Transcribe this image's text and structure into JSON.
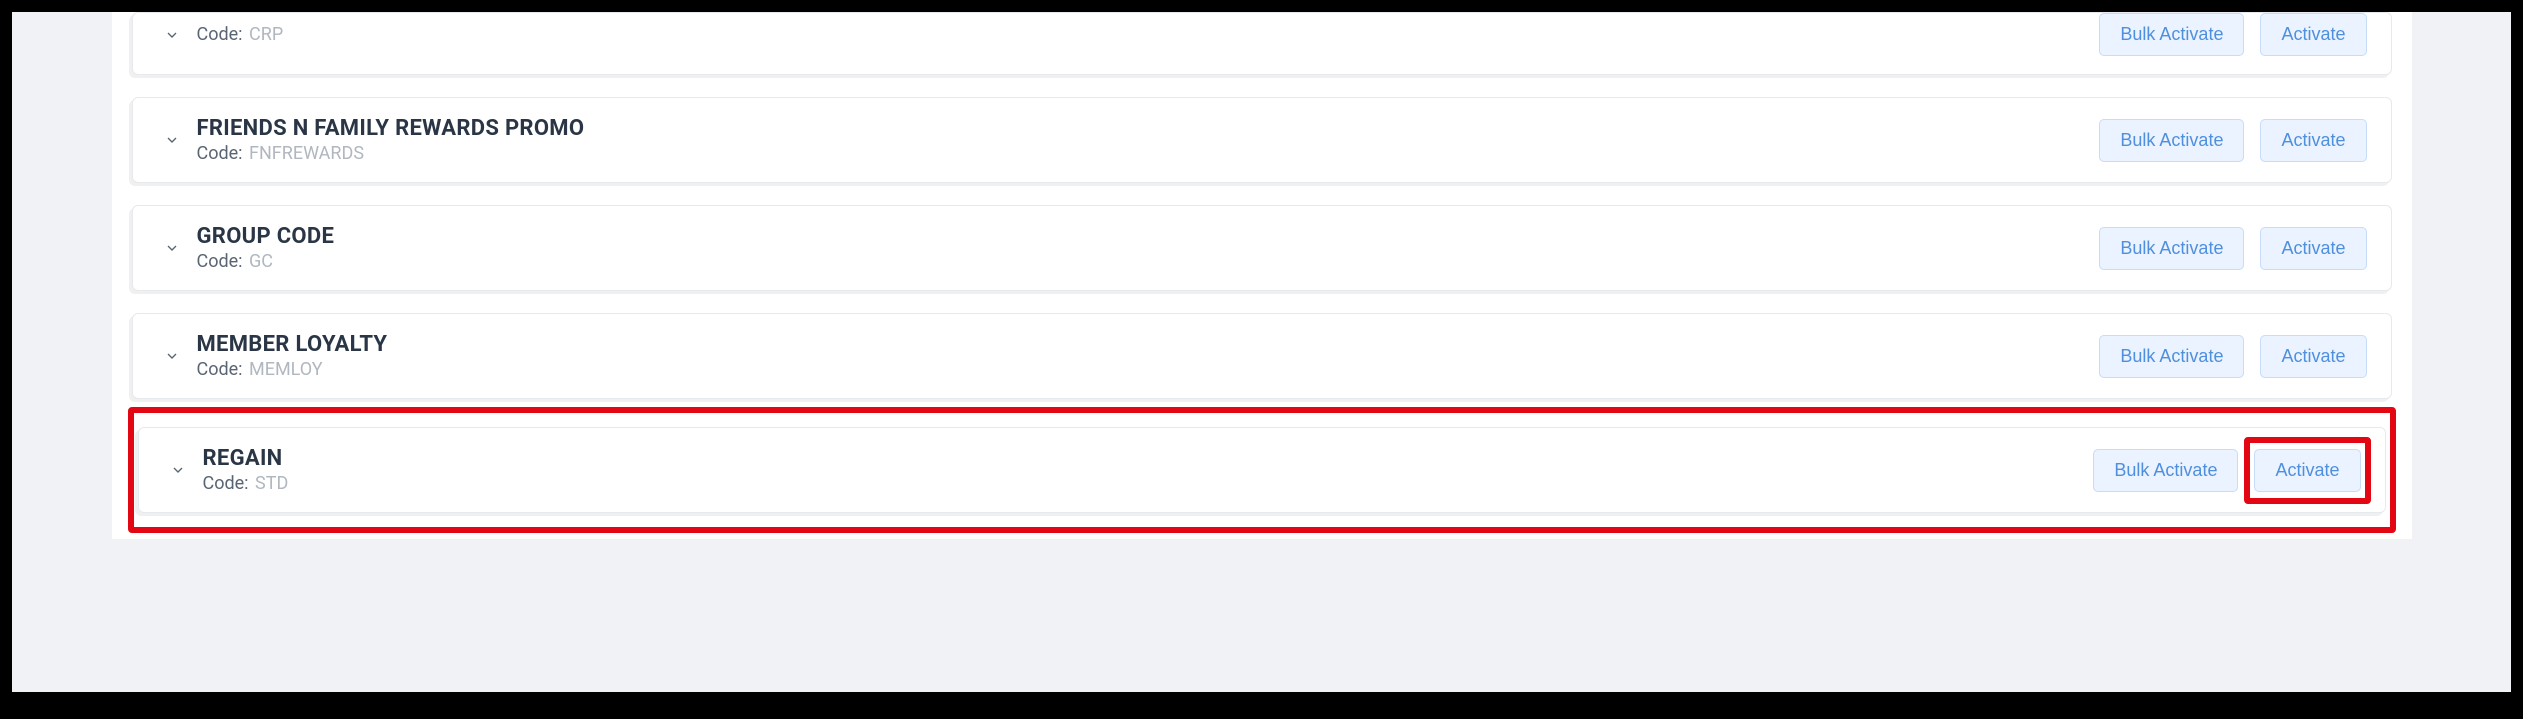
{
  "labels": {
    "code": "Code:",
    "bulk_activate": "Bulk Activate",
    "activate": "Activate"
  },
  "items": [
    {
      "title": "",
      "code": "CRP",
      "partial": true
    },
    {
      "title": "FRIENDS N FAMILY REWARDS PROMO",
      "code": "FNFREWARDS",
      "partial": false
    },
    {
      "title": "GROUP CODE",
      "code": "GC",
      "partial": false
    },
    {
      "title": "MEMBER LOYALTY",
      "code": "MEMLOY",
      "partial": false
    },
    {
      "title": "REGAIN",
      "code": "STD",
      "partial": false,
      "highlighted": true
    }
  ]
}
